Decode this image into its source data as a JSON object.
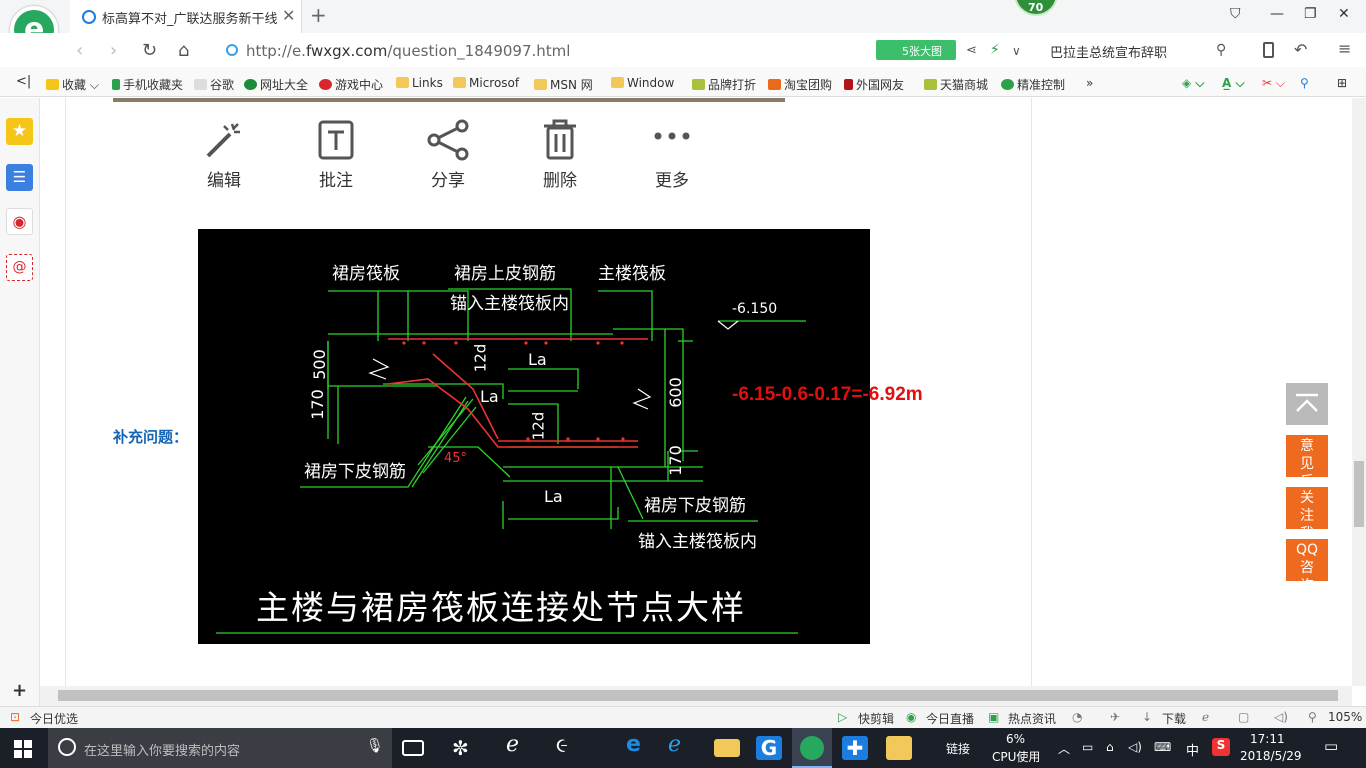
{
  "browser": {
    "tab_title": "标高算不对_广联达服务新干线",
    "score_badge": "70",
    "url_host": "http://e.",
    "url_domain": "fwxgx.com",
    "url_path": "/question_1849097.html",
    "big_image_label": "5张大图",
    "search_text": "巴拉圭总统宣布辞职",
    "new_tab": "+",
    "tab_close": "✕"
  },
  "bookmarks": [
    "收藏",
    "手机收藏夹",
    "谷歌",
    "网址大全",
    "游戏中心",
    "Links",
    "Microsof",
    "MSN 网",
    "Window",
    "品牌打折",
    "淘宝团购",
    "外国网友",
    "天猫商城",
    "精准控制"
  ],
  "toolbar": {
    "edit": "编辑",
    "annotate": "批注",
    "share": "分享",
    "delete": "删除",
    "more": "更多"
  },
  "question": {
    "supplement_label": "补充问题：",
    "annotation": "-6.15-0.6-0.17=-6.92m"
  },
  "cad": {
    "title": "主楼与裙房筏板连接处节点大样",
    "label_skirt_raft": "裙房筏板",
    "label_top_rebar_1": "裙房上皮钢筋",
    "label_top_rebar_2": "锚入主楼筏板内",
    "label_main_raft": "主楼筏板",
    "label_elev": "-6.150",
    "label_500": "500",
    "label_170a": "170",
    "label_12d_a": "12d",
    "label_12d_b": "12d",
    "label_la_a": "La",
    "label_la_b": "La",
    "label_la_c": "La",
    "label_600": "600",
    "label_170b": "170",
    "label_bottom_rebar_left": "裙房下皮钢筋",
    "label_45": "45°",
    "label_bottom_rebar_1": "裙房下皮钢筋",
    "label_bottom_rebar_2": "锚入主楼筏板内"
  },
  "float_buttons": {
    "feedback": "意见反馈",
    "follow": "关注我们",
    "qq": "QQ咨询"
  },
  "statusbar": {
    "left": "今日优选",
    "quick_clip": "快剪辑",
    "live": "今日直播",
    "news": "热点资讯",
    "download": "下载",
    "zoom": "105%"
  },
  "taskbar": {
    "search_placeholder": "在这里输入你要搜索的内容",
    "link": "链接",
    "cpu_percent": "6%",
    "cpu_label": "CPU使用",
    "ime": "中",
    "time": "17:11",
    "date": "2018/5/29"
  },
  "colors": {
    "accent_green": "#3cbf6b",
    "link_blue": "#1565b4",
    "annotation_red": "#e01010",
    "float_orange": "#ee6a1f"
  }
}
